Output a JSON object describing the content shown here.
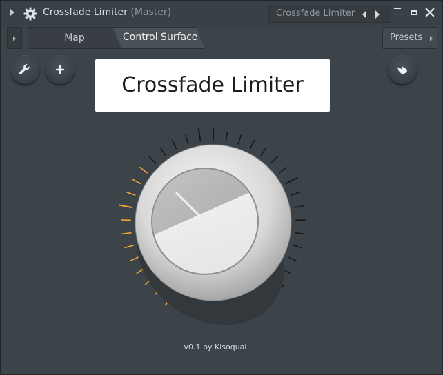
{
  "window": {
    "title": "Crossfade Limiter",
    "title_suffix": "(Master)",
    "preset_name": "Crossfade Limiter",
    "icons": {
      "menu": "triangle-right-icon",
      "plugin": "gear-icon",
      "prev": "triangle-left-icon",
      "next": "triangle-right-icon",
      "minimize": "minimize-icon",
      "maximize": "maximize-icon",
      "close": "close-icon"
    }
  },
  "tabs": {
    "items": [
      {
        "label": "Map",
        "active": false
      },
      {
        "label": "Control Surface",
        "active": true
      }
    ],
    "presets_label": "Presets"
  },
  "toolbar": {
    "buttons": [
      {
        "icon": "wrench-icon"
      },
      {
        "icon": "plus-icon",
        "label": "+"
      },
      {
        "icon": "hand-pointer-icon"
      }
    ]
  },
  "surface": {
    "title": "Crossfade Limiter",
    "knob": {
      "value_fraction": 0.35,
      "tick_count": 35
    },
    "footer": "v0.1 by Kisoqual"
  },
  "colors": {
    "accent": "#f0a430",
    "background": "#3d4449",
    "tick_inactive": "#16191b",
    "title_box": "#ffffff"
  }
}
